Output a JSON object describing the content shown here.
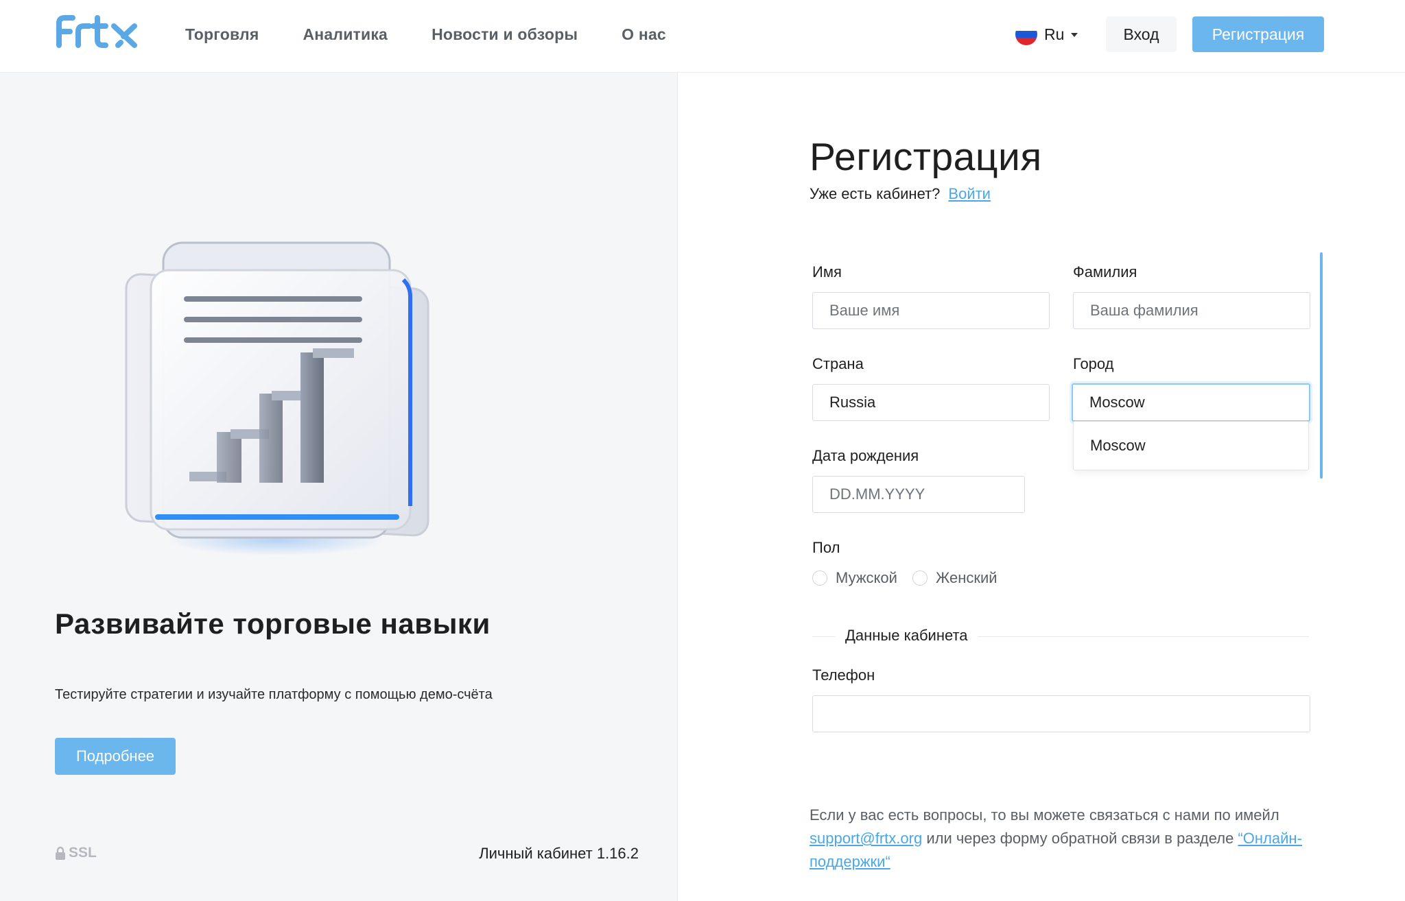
{
  "header": {
    "nav": [
      "Торговля",
      "Аналитика",
      "Новости и обзоры",
      "О нас"
    ],
    "lang": "Ru",
    "login_label": "Вход",
    "register_label": "Регистрация"
  },
  "promo": {
    "title": "Развивайте торговые навыки",
    "text": "Тестируйте стратегии и изучайте платформу с помощью демо-счёта",
    "more_label": "Подробнее",
    "ssl_label": "SSL",
    "version": "Личный кабинет 1.16.2"
  },
  "form": {
    "title": "Регистрация",
    "has_account": "Уже есть кабинет?",
    "login_link": "Войти",
    "first_name": {
      "label": "Имя",
      "placeholder": "Ваше имя",
      "value": ""
    },
    "last_name": {
      "label": "Фамилия",
      "placeholder": "Ваша фамилия",
      "value": ""
    },
    "country": {
      "label": "Страна",
      "value": "Russia"
    },
    "city": {
      "label": "Город",
      "value": "Moscow",
      "suggestions": [
        "Moscow"
      ]
    },
    "birth_date": {
      "label": "Дата рождения",
      "placeholder": "DD.MM.YYYY"
    },
    "gender": {
      "label": "Пол",
      "options": [
        "Мужской",
        "Женский"
      ]
    },
    "section_account": "Данные кабинета",
    "phone": {
      "label": "Телефон",
      "value": ""
    }
  },
  "help": {
    "text_before": "Если у вас есть вопросы, то вы можете связаться с нами по имейл",
    "email": "support@frtx.org",
    "text_middle": "или через форму обратной связи в разделе",
    "support_link": "“Онлайн-поддержки“"
  },
  "colors": {
    "accent": "#6bb6ec",
    "link": "#4aa7e6",
    "logo": "#5aa9e6",
    "left_bg": "#f5f6f8"
  },
  "icons": [
    "logo",
    "ru-flag-icon",
    "chevron-down-icon",
    "lock-icon",
    "hero-illustration"
  ]
}
